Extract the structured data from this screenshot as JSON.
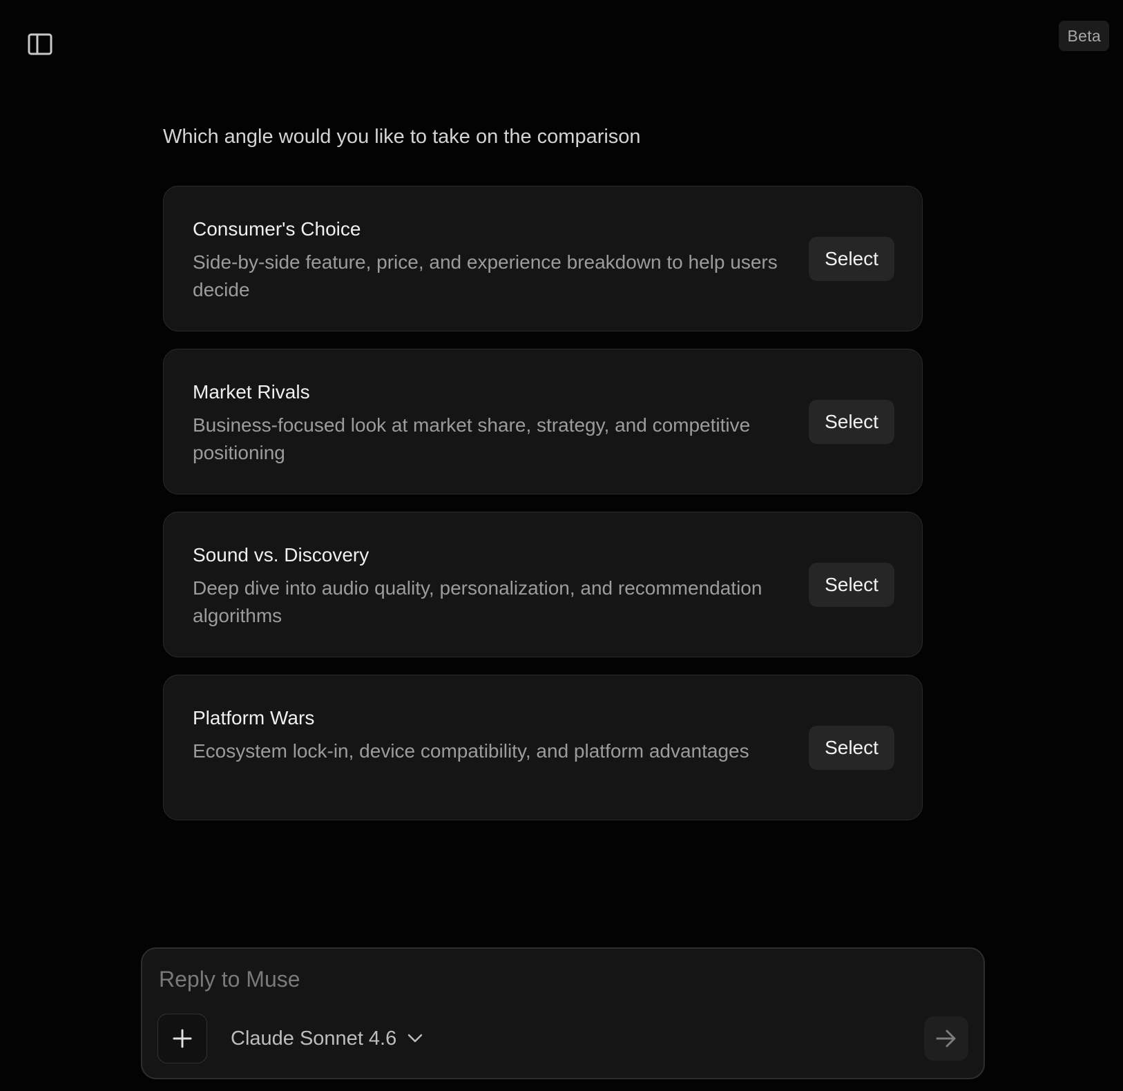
{
  "header": {
    "beta_label": "Beta"
  },
  "question": "Which angle would you like to take on the comparison",
  "options": [
    {
      "title": "Consumer's Choice",
      "description": "Side-by-side feature, price, and experience breakdown to help users decide",
      "button_label": "Select"
    },
    {
      "title": "Market Rivals",
      "description": "Business-focused look at market share, strategy, and competitive positioning",
      "button_label": "Select"
    },
    {
      "title": "Sound vs. Discovery",
      "description": "Deep dive into audio quality, personalization, and recommendation algorithms",
      "button_label": "Select"
    },
    {
      "title": "Platform Wars",
      "description": "Ecosystem lock-in, device compatibility, and platform advantages",
      "button_label": "Select"
    }
  ],
  "composer": {
    "placeholder": "Reply to Muse",
    "value": "",
    "model_label": "Claude Sonnet 4.6"
  },
  "icons": {
    "sidebar_toggle": "sidebar-panel-icon",
    "add": "plus-icon",
    "model_dropdown": "chevron-down-icon",
    "send": "arrow-right-icon"
  },
  "colors": {
    "background": "#030303",
    "card_background": "#151515",
    "card_border": "#2a2a2a",
    "button_background": "#262626",
    "title_text": "#f0f0f0",
    "description_text": "#9c9c9c"
  }
}
